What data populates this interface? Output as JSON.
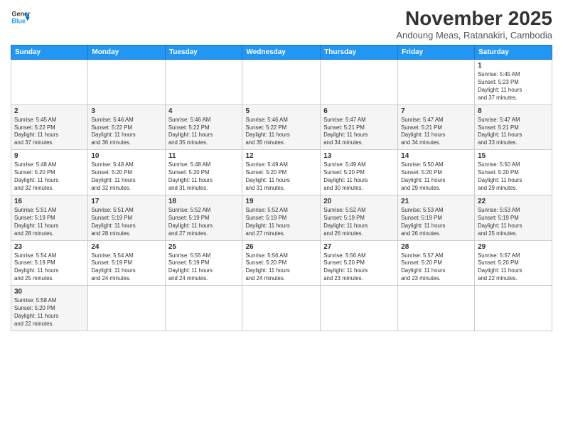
{
  "logo": {
    "line1": "General",
    "line2": "Blue"
  },
  "header": {
    "title": "November 2025",
    "subtitle": "Andoung Meas, Ratanakiri, Cambodia"
  },
  "weekdays": [
    "Sunday",
    "Monday",
    "Tuesday",
    "Wednesday",
    "Thursday",
    "Friday",
    "Saturday"
  ],
  "weeks": [
    [
      {
        "day": "",
        "info": ""
      },
      {
        "day": "",
        "info": ""
      },
      {
        "day": "",
        "info": ""
      },
      {
        "day": "",
        "info": ""
      },
      {
        "day": "",
        "info": ""
      },
      {
        "day": "",
        "info": ""
      },
      {
        "day": "1",
        "info": "Sunrise: 5:45 AM\nSunset: 5:23 PM\nDaylight: 11 hours\nand 37 minutes."
      }
    ],
    [
      {
        "day": "2",
        "info": "Sunrise: 5:45 AM\nSunset: 5:22 PM\nDaylight: 11 hours\nand 37 minutes."
      },
      {
        "day": "3",
        "info": "Sunrise: 5:46 AM\nSunset: 5:22 PM\nDaylight: 11 hours\nand 36 minutes."
      },
      {
        "day": "4",
        "info": "Sunrise: 5:46 AM\nSunset: 5:22 PM\nDaylight: 11 hours\nand 35 minutes."
      },
      {
        "day": "5",
        "info": "Sunrise: 5:46 AM\nSunset: 5:22 PM\nDaylight: 11 hours\nand 35 minutes."
      },
      {
        "day": "6",
        "info": "Sunrise: 5:47 AM\nSunset: 5:21 PM\nDaylight: 11 hours\nand 34 minutes."
      },
      {
        "day": "7",
        "info": "Sunrise: 5:47 AM\nSunset: 5:21 PM\nDaylight: 11 hours\nand 34 minutes."
      },
      {
        "day": "8",
        "info": "Sunrise: 5:47 AM\nSunset: 5:21 PM\nDaylight: 11 hours\nand 33 minutes."
      }
    ],
    [
      {
        "day": "9",
        "info": "Sunrise: 5:48 AM\nSunset: 5:20 PM\nDaylight: 11 hours\nand 32 minutes."
      },
      {
        "day": "10",
        "info": "Sunrise: 5:48 AM\nSunset: 5:20 PM\nDaylight: 11 hours\nand 32 minutes."
      },
      {
        "day": "11",
        "info": "Sunrise: 5:48 AM\nSunset: 5:20 PM\nDaylight: 11 hours\nand 31 minutes."
      },
      {
        "day": "12",
        "info": "Sunrise: 5:49 AM\nSunset: 5:20 PM\nDaylight: 11 hours\nand 31 minutes."
      },
      {
        "day": "13",
        "info": "Sunrise: 5:49 AM\nSunset: 5:20 PM\nDaylight: 11 hours\nand 30 minutes."
      },
      {
        "day": "14",
        "info": "Sunrise: 5:50 AM\nSunset: 5:20 PM\nDaylight: 11 hours\nand 29 minutes."
      },
      {
        "day": "15",
        "info": "Sunrise: 5:50 AM\nSunset: 5:20 PM\nDaylight: 11 hours\nand 29 minutes."
      }
    ],
    [
      {
        "day": "16",
        "info": "Sunrise: 5:51 AM\nSunset: 5:19 PM\nDaylight: 11 hours\nand 28 minutes."
      },
      {
        "day": "17",
        "info": "Sunrise: 5:51 AM\nSunset: 5:19 PM\nDaylight: 11 hours\nand 28 minutes."
      },
      {
        "day": "18",
        "info": "Sunrise: 5:52 AM\nSunset: 5:19 PM\nDaylight: 11 hours\nand 27 minutes."
      },
      {
        "day": "19",
        "info": "Sunrise: 5:52 AM\nSunset: 5:19 PM\nDaylight: 11 hours\nand 27 minutes."
      },
      {
        "day": "20",
        "info": "Sunrise: 5:52 AM\nSunset: 5:19 PM\nDaylight: 11 hours\nand 26 minutes."
      },
      {
        "day": "21",
        "info": "Sunrise: 5:53 AM\nSunset: 5:19 PM\nDaylight: 11 hours\nand 26 minutes."
      },
      {
        "day": "22",
        "info": "Sunrise: 5:53 AM\nSunset: 5:19 PM\nDaylight: 11 hours\nand 25 minutes."
      }
    ],
    [
      {
        "day": "23",
        "info": "Sunrise: 5:54 AM\nSunset: 5:19 PM\nDaylight: 11 hours\nand 25 minutes."
      },
      {
        "day": "24",
        "info": "Sunrise: 5:54 AM\nSunset: 5:19 PM\nDaylight: 11 hours\nand 24 minutes."
      },
      {
        "day": "25",
        "info": "Sunrise: 5:55 AM\nSunset: 5:19 PM\nDaylight: 11 hours\nand 24 minutes."
      },
      {
        "day": "26",
        "info": "Sunrise: 5:56 AM\nSunset: 5:20 PM\nDaylight: 11 hours\nand 24 minutes."
      },
      {
        "day": "27",
        "info": "Sunrise: 5:56 AM\nSunset: 5:20 PM\nDaylight: 11 hours\nand 23 minutes."
      },
      {
        "day": "28",
        "info": "Sunrise: 5:57 AM\nSunset: 5:20 PM\nDaylight: 11 hours\nand 23 minutes."
      },
      {
        "day": "29",
        "info": "Sunrise: 5:57 AM\nSunset: 5:20 PM\nDaylight: 11 hours\nand 22 minutes."
      }
    ],
    [
      {
        "day": "30",
        "info": "Sunrise: 5:58 AM\nSunset: 5:20 PM\nDaylight: 11 hours\nand 22 minutes."
      },
      {
        "day": "",
        "info": ""
      },
      {
        "day": "",
        "info": ""
      },
      {
        "day": "",
        "info": ""
      },
      {
        "day": "",
        "info": ""
      },
      {
        "day": "",
        "info": ""
      },
      {
        "day": "",
        "info": ""
      }
    ]
  ]
}
